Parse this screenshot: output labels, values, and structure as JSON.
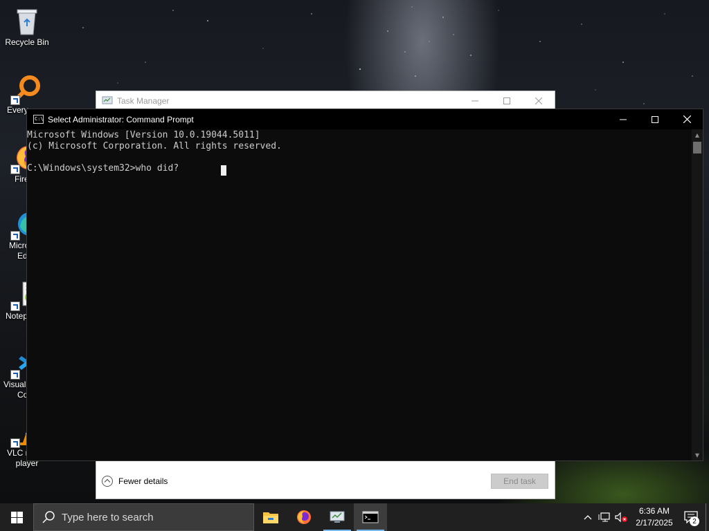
{
  "desktop": {
    "icons": [
      {
        "label": "Recycle Bin",
        "icon": "recycle-bin-icon"
      },
      {
        "label": "Every",
        "icon": "everything-search-icon"
      },
      {
        "label": "Fire",
        "icon": "firefox-icon"
      },
      {
        "label": "Micro",
        "label2": "Ed",
        "icon": "edge-icon"
      },
      {
        "label": "Notep",
        "icon": "notepad-plus-plus-icon"
      },
      {
        "label": "Visual",
        "label2": "Co",
        "icon": "vscode-icon"
      },
      {
        "label": "VLC m",
        "label2": "player",
        "icon": "vlc-icon"
      }
    ]
  },
  "task_manager": {
    "title": "Task Manager",
    "fewer_details": "Fewer details",
    "end_task": "End task"
  },
  "cmd": {
    "title": "Select Administrator: Command Prompt",
    "lines": [
      "Microsoft Windows [Version 10.0.19044.5011]",
      "(c) Microsoft Corporation. All rights reserved.",
      "",
      "C:\\Windows\\system32>who did?"
    ]
  },
  "taskbar": {
    "search_placeholder": "Type here to search",
    "apps": [
      {
        "name": "file-explorer-icon"
      },
      {
        "name": "firefox-icon"
      },
      {
        "name": "task-manager-icon"
      },
      {
        "name": "command-prompt-icon"
      }
    ],
    "time": "6:36 AM",
    "date": "2/17/2025",
    "notification_count": "2"
  },
  "colors": {
    "cmd_background": "#0c0c0c",
    "cmd_text": "#cccccc",
    "taskbar": "#202020",
    "running_indicator": "#76b9ed"
  }
}
